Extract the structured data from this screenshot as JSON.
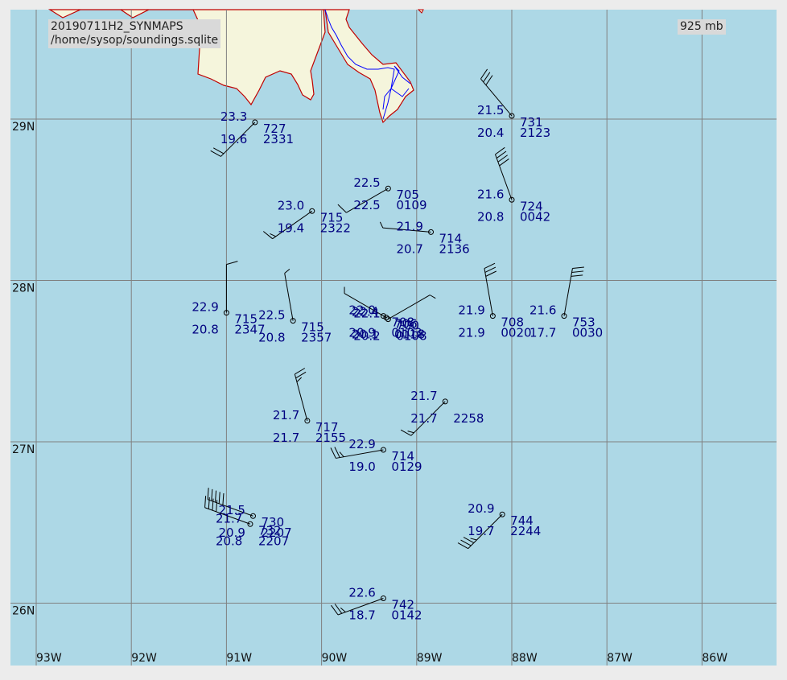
{
  "header": {
    "product": "20190711H2_SYNMAPS",
    "source": "/home/sysop/soundings.sqlite",
    "level": "925 mb"
  },
  "colors": {
    "water": "#add8e6",
    "land": "#f5f5dc",
    "coast": "#c00000",
    "river": "#0000ff",
    "grid": "#808080",
    "station": "#000080",
    "barb": "#000000"
  },
  "lat_labels": [
    "29N",
    "28N",
    "27N",
    "26N"
  ],
  "lon_labels": [
    "93W",
    "92W",
    "91W",
    "90W",
    "89W",
    "88W",
    "87W",
    "86W"
  ],
  "stations": [
    {
      "lon": -90.7,
      "lat": 28.98,
      "t": "23.3",
      "td": "19.6",
      "z": "727",
      "time": "2331",
      "wdir": 225,
      "wspd": 20
    },
    {
      "lon": -89.3,
      "lat": 28.57,
      "t": "22.5",
      "td": "22.5",
      "z": "705",
      "time": "0109",
      "wdir": 240,
      "wspd": 10
    },
    {
      "lon": -90.1,
      "lat": 28.43,
      "t": "23.0",
      "td": "19.4",
      "z": "715",
      "time": "2322",
      "wdir": 235,
      "wspd": 15
    },
    {
      "lon": -88.0,
      "lat": 29.02,
      "t": "21.5",
      "td": "20.4",
      "z": "731",
      "time": "2123",
      "wdir": 320,
      "wspd": 30
    },
    {
      "lon": -88.0,
      "lat": 28.5,
      "t": "21.6",
      "td": "20.8",
      "z": "724",
      "time": "0042",
      "wdir": 340,
      "wspd": 40
    },
    {
      "lon": -88.85,
      "lat": 28.3,
      "t": "21.9",
      "td": "20.7",
      "z": "714",
      "time": "2136",
      "wdir": 275,
      "wspd": 5
    },
    {
      "lon": -91.0,
      "lat": 27.8,
      "t": "22.9",
      "td": "20.8",
      "z": "715",
      "time": "2347",
      "wdir": 0,
      "wspd": 10
    },
    {
      "lon": -90.3,
      "lat": 27.75,
      "t": "22.5",
      "td": "20.8",
      "z": "715",
      "time": "2357",
      "wdir": 350,
      "wspd": 5
    },
    {
      "lon": -89.35,
      "lat": 27.78,
      "t": "22.0",
      "td": "20.9",
      "z": "708",
      "time": "0103",
      "wdir": 330,
      "wspd": 0
    },
    {
      "lon": -89.32,
      "lat": 27.77,
      "t": "22.4",
      "td": "20.1",
      "z": "706",
      "time": "0118",
      "wdir": 300,
      "wspd": 5
    },
    {
      "lon": -89.3,
      "lat": 27.76,
      "t": "22.1",
      "td": "20.2",
      "z": "700",
      "time": "0108",
      "wdir": 60,
      "wspd": 5
    },
    {
      "lon": -88.2,
      "lat": 27.78,
      "t": "21.9",
      "td": "21.9",
      "z": "708",
      "time": "0020",
      "wdir": 350,
      "wspd": 30
    },
    {
      "lon": -87.45,
      "lat": 27.78,
      "t": "21.6",
      "td": "17.7",
      "z": "753",
      "time": "0030",
      "wdir": 10,
      "wspd": 30
    },
    {
      "lon": -90.15,
      "lat": 27.13,
      "t": "21.7",
      "td": "21.7",
      "z": "717",
      "time": "2155",
      "wdir": 345,
      "wspd": 25
    },
    {
      "lon": -88.7,
      "lat": 27.25,
      "t": "21.7",
      "td": "21.7",
      "z": "",
      "time": "2258",
      "wdir": 225,
      "wspd": 15
    },
    {
      "lon": -89.35,
      "lat": 26.95,
      "t": "22.9",
      "td": "19.0",
      "z": "714",
      "time": "0129",
      "wdir": 260,
      "wspd": 25
    },
    {
      "lon": -90.72,
      "lat": 26.54,
      "t": "21.5",
      "td": "20.9",
      "z": "730",
      "time": "2207",
      "wdir": 290,
      "wspd": 50
    },
    {
      "lon": -90.75,
      "lat": 26.49,
      "t": "21.7",
      "td": "20.8",
      "z": "732",
      "time": "2207",
      "wdir": 290,
      "wspd": 40
    },
    {
      "lon": -88.1,
      "lat": 26.55,
      "t": "20.9",
      "td": "19.7",
      "z": "744",
      "time": "2244",
      "wdir": 225,
      "wspd": 35
    },
    {
      "lon": -89.35,
      "lat": 26.03,
      "t": "22.6",
      "td": "18.7",
      "z": "742",
      "time": "0142",
      "wdir": 250,
      "wspd": 25
    }
  ]
}
